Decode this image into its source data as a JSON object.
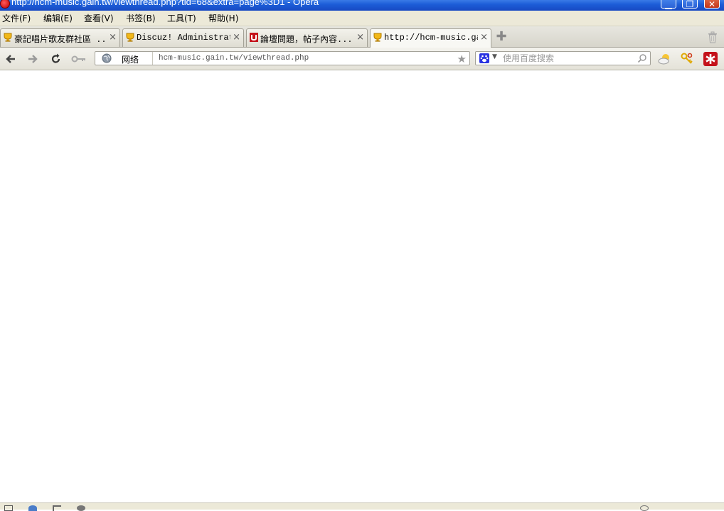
{
  "window": {
    "title": "http://hcm-music.gain.tw/viewthread.php?tid=68&extra=page%3D1 - Opera",
    "controls": [
      "minimize-icon",
      "restore-icon",
      "close-icon"
    ]
  },
  "menu": {
    "items": [
      "文件(F)",
      "编辑(E)",
      "查看(V)",
      "书签(B)",
      "工具(T)",
      "帮助(H)"
    ]
  },
  "tabs": [
    {
      "label": "豪記唱片歌友群社區 ...",
      "icon": "trophy-icon",
      "active": false
    },
    {
      "label": "Discuz! Administrat...",
      "icon": "trophy-icon",
      "active": false
    },
    {
      "label": "論壇問題，帖子內容...",
      "icon": "site-u-icon",
      "active": false
    },
    {
      "label": "http://hcm-music.ga...",
      "icon": "trophy-icon",
      "active": true
    }
  ],
  "navbar": {
    "address_zone": "网络",
    "url": "hcm-music.gain.tw/viewthread.php",
    "search_placeholder": "使用百度搜索"
  },
  "colors": {
    "titlebar": "#1d5ed8",
    "chrome": "#ece9d8",
    "page_background": "#ffffff"
  }
}
